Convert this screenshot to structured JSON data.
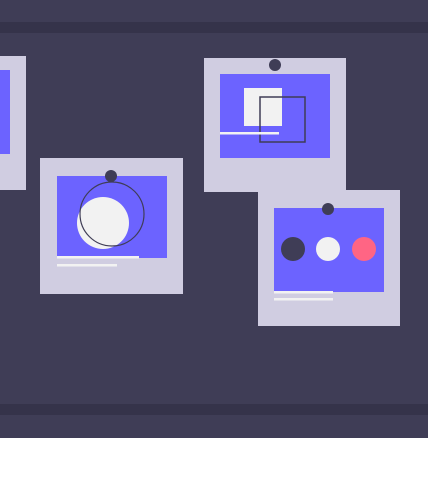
{
  "colors": {
    "wall": "#3f3d56",
    "rail": "#35334a",
    "card": "#d0cde1",
    "panel": "#6c63ff",
    "pin": "#3f3d56",
    "light": "#f2f2f2",
    "accent": "#ff6584",
    "background": "#ffffff"
  },
  "icons": [
    "pin-icon",
    "circle-icon",
    "square-icon",
    "dots-icon"
  ]
}
